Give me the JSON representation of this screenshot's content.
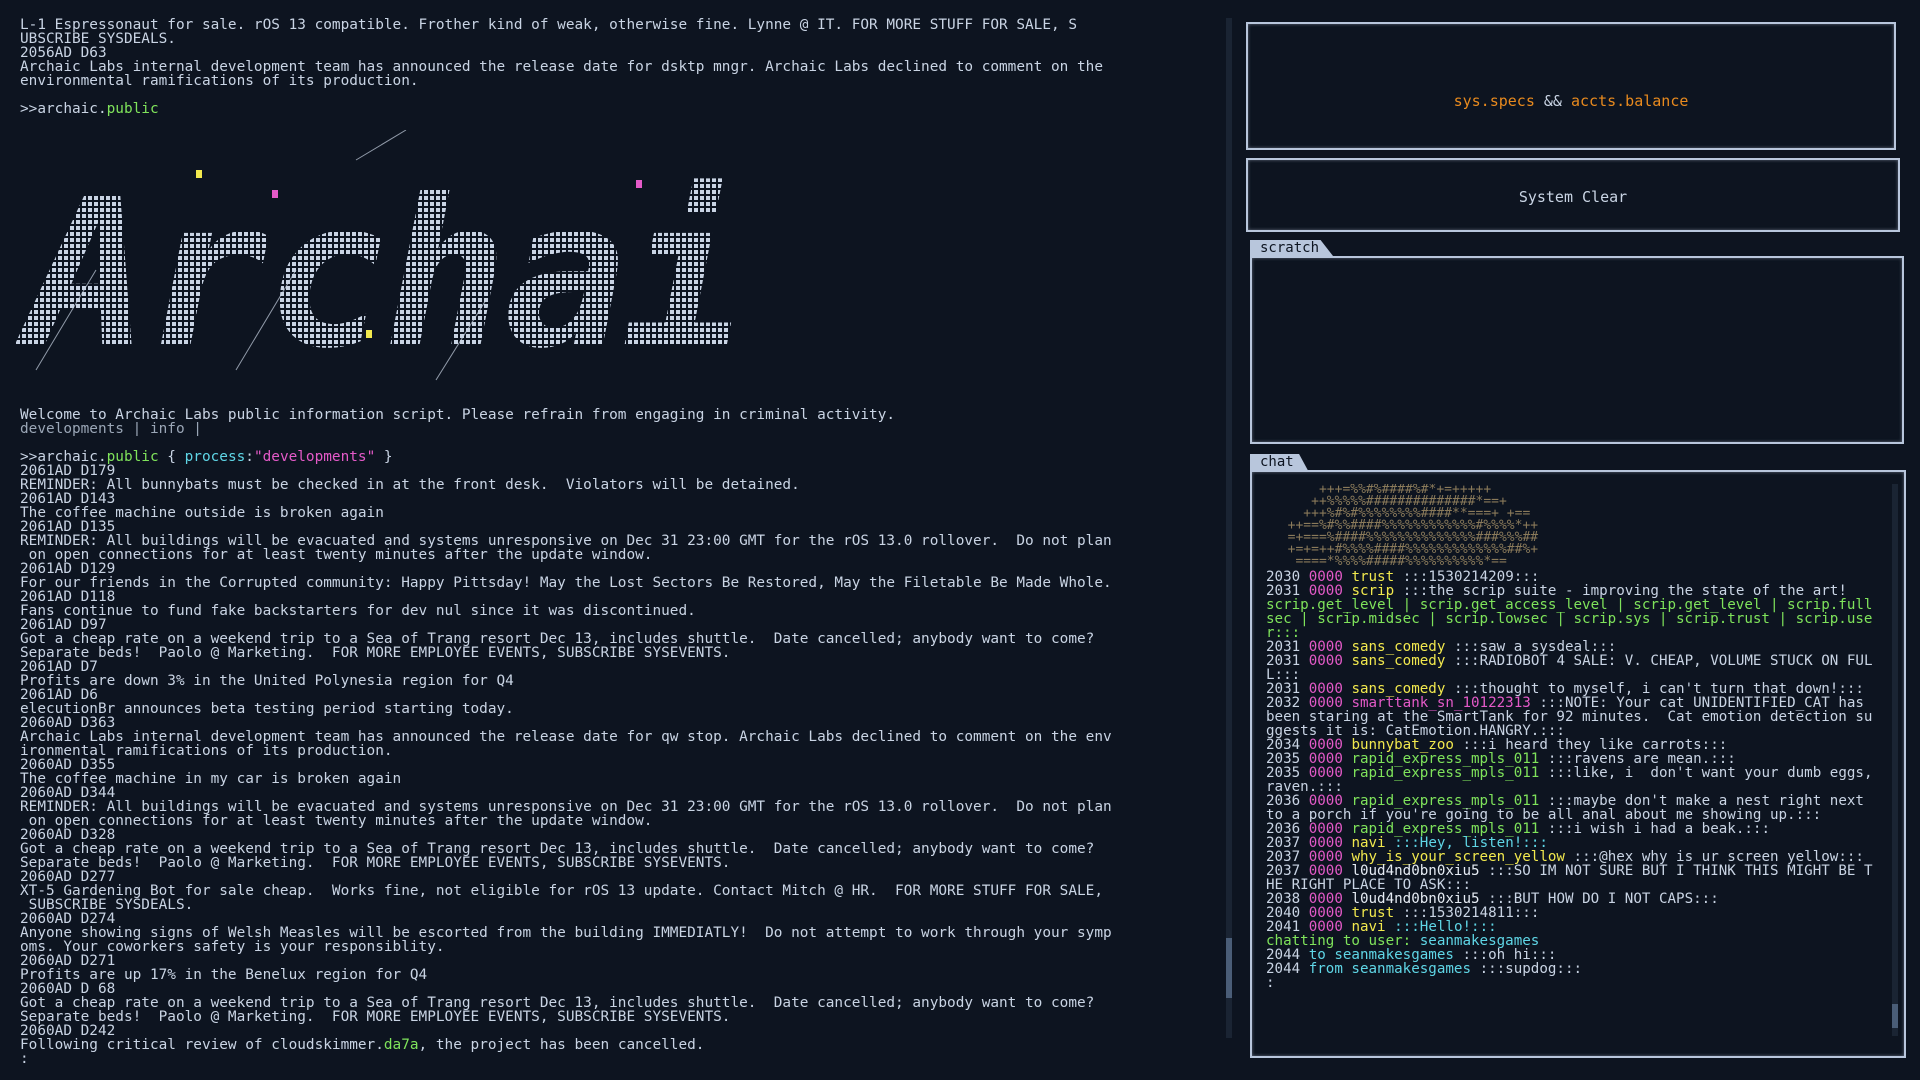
{
  "terminal": {
    "header_lines": [
      "L-1 Espressonaut for sale. rOS 13 compatible. Frother kind of weak, otherwise fine. Lynne @ IT. FOR MORE STUFF FOR SALE, S",
      "UBSCRIBE SYSDEALS.",
      "2056AD D63",
      "Archaic Labs internal development team has announced the release date for dsktp_mngr. Archaic Labs declined to comment on the",
      "environmental ramifications of its production."
    ],
    "cmd1": {
      "prompt": ">>",
      "head": "archaic.",
      "tail": "public"
    },
    "logo_text": "Archaic",
    "welcome": "Welcome to Archaic Labs public information script. Please refrain from engaging in criminal activity.",
    "welcome_sub": "developments | info |",
    "cmd2": {
      "prompt": ">>",
      "head": "archaic.",
      "tail": "public",
      "open": " { ",
      "key": "process",
      "colon": ":",
      "value": "\"developments\"",
      "close": " }"
    },
    "log_lines": [
      "2061AD D179",
      "REMINDER: All bunnybats must be checked in at the front desk.  Violators will be detained.",
      "2061AD D143",
      "The coffee machine outside is broken again",
      "2061AD D135",
      "REMINDER: All buildings will be evacuated and systems unresponsive on Dec 31 23:00 GMT for the rOS 13.0 rollover.  Do not plan",
      " on open connections for at least twenty minutes after the update window.",
      "2061AD D129",
      "For our friends in the Corrupted community: Happy Pittsday! May the Lost Sectors Be Restored, May the Filetable Be Made Whole.",
      "2061AD D118",
      "Fans continue to fund fake backstarters for dev_nul since it was discontinued.",
      "2061AD D97",
      "Got a cheap rate on a weekend trip to a Sea of Trang resort Dec 13, includes shuttle.  Date cancelled; anybody want to come?",
      "Separate beds!  Paolo @ Marketing.  FOR MORE EMPLOYEE EVENTS, SUBSCRIBE SYSEVENTS.",
      "2061AD D7",
      "Profits are down 3% in the United Polynesia region for Q4",
      "2061AD D6",
      "elecutionBr announces beta testing period starting today.",
      "2060AD D363",
      "Archaic Labs internal development team has announced the release date for qw_stop. Archaic Labs declined to comment on the env",
      "ironmental ramifications of its production.",
      "2060AD D355",
      "The coffee machine in my car is broken again",
      "2060AD D344",
      "REMINDER: All buildings will be evacuated and systems unresponsive on Dec 31 23:00 GMT for the rOS 13.0 rollover.  Do not plan",
      " on open connections for at least twenty minutes after the update window.",
      "2060AD D328",
      "Got a cheap rate on a weekend trip to a Sea of Trang resort Dec 13, includes shuttle.  Date cancelled; anybody want to come?",
      "Separate beds!  Paolo @ Marketing.  FOR MORE EMPLOYEE EVENTS, SUBSCRIBE SYSEVENTS.",
      "2060AD D277",
      "XT-5 Gardening Bot for sale cheap.  Works fine, not eligible for rOS 13 update. Contact Mitch @ HR.  FOR MORE STUFF FOR SALE,",
      " SUBSCRIBE SYSDEALS.",
      "2060AD D274",
      "Anyone showing signs of Welsh Measles will be escorted from the building IMMEDIATLY!  Do not attempt to work through your symp",
      "oms. Your coworkers safety is your responsiblity.",
      "2060AD D271",
      "Profits are up 17% in the Benelux region for Q4",
      "2060AD D 68",
      "Got a cheap rate on a weekend trip to a Sea of Trang resort Dec 13, includes shuttle.  Date cancelled; anybody want to come?",
      "Separate beds!  Paolo @ Marketing.  FOR MORE EMPLOYEE EVENTS, SUBSCRIBE SYSEVENTS.",
      "2060AD D242"
    ],
    "last_line": {
      "pre": "Following critical review of cloudskimmer.",
      "hl": "da7a",
      "post": ", the project has been cancelled."
    },
    "prompt_char": ":"
  },
  "specs": {
    "a": "sys.specs",
    "sep": " && ",
    "b": "accts.balance"
  },
  "clear": {
    "label": "System Clear"
  },
  "scratch": {
    "tab": "scratch"
  },
  "chat": {
    "tab": "chat",
    "art_lines": [
      "      +++=%%#%####%#*+=+++++     ",
      "     ++%%%%%##############*==+   ",
      "    +++%#%#%%%%%%%%####**===+ +==",
      "  ++==%#%%####%%%%%%%%%%%%#%%%%*++",
      "  =+===%####%%%%%%%%%%%%%%###%%%##",
      "  +=+=++#%%%%####%%%%%%%%%%%%%##%+",
      "   ====*%%%%#####%%%%%%%%%%*==    "
    ],
    "rows": [
      {
        "yr": "2030",
        "uid": "0000",
        "user": "trust",
        "ucls": "usr",
        "msg": ":::1530214209:::",
        "mcls": "msg"
      },
      {
        "yr": "2031",
        "uid": "0000",
        "user": "scrip",
        "ucls": "usr",
        "msg": ":::the scrip suite - improving the state of the art!",
        "mcls": "msg"
      },
      {
        "yr": "",
        "uid": "",
        "user": "",
        "ucls": "msg-g",
        "msg": "scrip.get_level | scrip.get_access_level | scrip.get_level | scrip.fullsec | scrip.midsec | scrip.lowsec | scrip.sys | scrip.trust | scrip.user:::",
        "mcls": "msg-g"
      },
      {
        "yr": "2031",
        "uid": "0000",
        "user": "sans_comedy",
        "ucls": "usr",
        "msg": ":::saw a sysdeal:::",
        "mcls": "msg"
      },
      {
        "yr": "2031",
        "uid": "0000",
        "user": "sans_comedy",
        "ucls": "usr",
        "msg": ":::RADIOBOT 4 SALE: V. CHEAP, VOLUME STUCK ON FULL:::",
        "mcls": "msg"
      },
      {
        "yr": "2031",
        "uid": "0000",
        "user": "sans_comedy",
        "ucls": "usr",
        "msg": ":::thought to myself, i can't turn that down!:::",
        "mcls": "msg"
      },
      {
        "yr": "2032",
        "uid": "0000",
        "user": "smarttank_sn_10122313",
        "ucls": "uid",
        "msg": ":::NOTE: Your cat UNIDENTIFIED_CAT has been staring at the SmartTank for 92 minutes.  Cat emotion detection suggests it is: CatEmotion.HANGRY.:::",
        "mcls": "msg"
      },
      {
        "yr": "2034",
        "uid": "0000",
        "user": "bunnybat_zoo",
        "ucls": "usr",
        "msg": ":::i heard they like carrots:::",
        "mcls": "msg"
      },
      {
        "yr": "2035",
        "uid": "0000",
        "user": "rapid_express_mpls_011",
        "ucls": "usr-g",
        "msg": ":::ravens are mean.:::",
        "mcls": "msg"
      },
      {
        "yr": "2035",
        "uid": "0000",
        "user": "rapid_express_mpls_011",
        "ucls": "usr-g",
        "msg": ":::like, i  don't want your dumb eggs, raven.:::",
        "mcls": "msg"
      },
      {
        "yr": "2036",
        "uid": "0000",
        "user": "rapid_express_mpls_011",
        "ucls": "usr-g",
        "msg": ":::maybe don't make a nest right next to a porch if you're going to be all anal about me showing up.:::",
        "mcls": "msg"
      },
      {
        "yr": "2036",
        "uid": "0000",
        "user": "rapid_express_mpls_011",
        "ucls": "usr-g",
        "msg": ":::i wish i had a beak.:::",
        "mcls": "msg"
      },
      {
        "yr": "2037",
        "uid": "0000",
        "user": "navi",
        "ucls": "usr",
        "msg": ":::Hey, listen!:::",
        "mcls": "msg-c"
      },
      {
        "yr": "2037",
        "uid": "0000",
        "user": "why_is_your_screen_yellow",
        "ucls": "usr",
        "msg": ":::@hex why is ur screen yellow:::",
        "mcls": "msg"
      },
      {
        "yr": "2037",
        "uid": "0000",
        "user": "l0ud4nd0bn0xiu5",
        "ucls": "usr-w",
        "msg": ":::SO IM NOT SURE BUT I THINK THIS MIGHT BE THE RIGHT PLACE TO ASK:::",
        "mcls": "msg"
      },
      {
        "yr": "2038",
        "uid": "0000",
        "user": "l0ud4nd0bn0xiu5",
        "ucls": "usr-w",
        "msg": ":::BUT HOW DO I NOT CAPS:::",
        "mcls": "msg"
      },
      {
        "yr": "2040",
        "uid": "0000",
        "user": "trust",
        "ucls": "usr",
        "msg": ":::1530214811:::",
        "mcls": "msg"
      },
      {
        "yr": "2041",
        "uid": "0000",
        "user": "navi",
        "ucls": "usr",
        "msg": ":::Hello!:::",
        "mcls": "msg-c"
      }
    ],
    "chatting_label": "chatting to user: ",
    "chatting_user": "seanmakesgames",
    "dm": [
      {
        "yr": "2044",
        "dir": "to seanmakesgames",
        "msg": ":::oh hi:::"
      },
      {
        "yr": "2044",
        "dir": "from seanmakesgames",
        "msg": ":::supdog:::"
      }
    ],
    "prompt_char": ":"
  },
  "colors": {
    "bg": "#0d1420",
    "frame": "#b8c6dc",
    "green": "#7fe35b",
    "magenta": "#e45ac8",
    "cyan": "#5fd6e6",
    "yellow": "#f2e94e",
    "orange": "#e88a1e"
  }
}
